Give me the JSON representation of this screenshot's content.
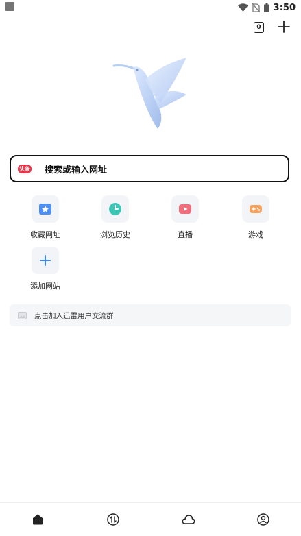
{
  "status_bar": {
    "time": "3:50"
  },
  "top_actions": {
    "tab_count": "0"
  },
  "search": {
    "badge": "头条",
    "placeholder": "搜索或输入网址"
  },
  "quick_links": [
    {
      "label": "收藏网址",
      "icon": "bookmark-star-icon",
      "color": "#4d8ff5"
    },
    {
      "label": "浏览历史",
      "icon": "history-clock-icon",
      "color": "#3cc6b6"
    },
    {
      "label": "直播",
      "icon": "live-video-icon",
      "color": "#f26d7b"
    },
    {
      "label": "游戏",
      "icon": "gamepad-icon",
      "color": "#f5a25f"
    },
    {
      "label": "添加网站",
      "icon": "add-site-icon",
      "color": "#3e86f0"
    }
  ],
  "banner": {
    "text": "点击加入迅雷用户交流群"
  },
  "bottom_nav": [
    {
      "icon": "home-icon"
    },
    {
      "icon": "transfer-icon"
    },
    {
      "icon": "cloud-icon"
    },
    {
      "icon": "profile-icon"
    }
  ]
}
